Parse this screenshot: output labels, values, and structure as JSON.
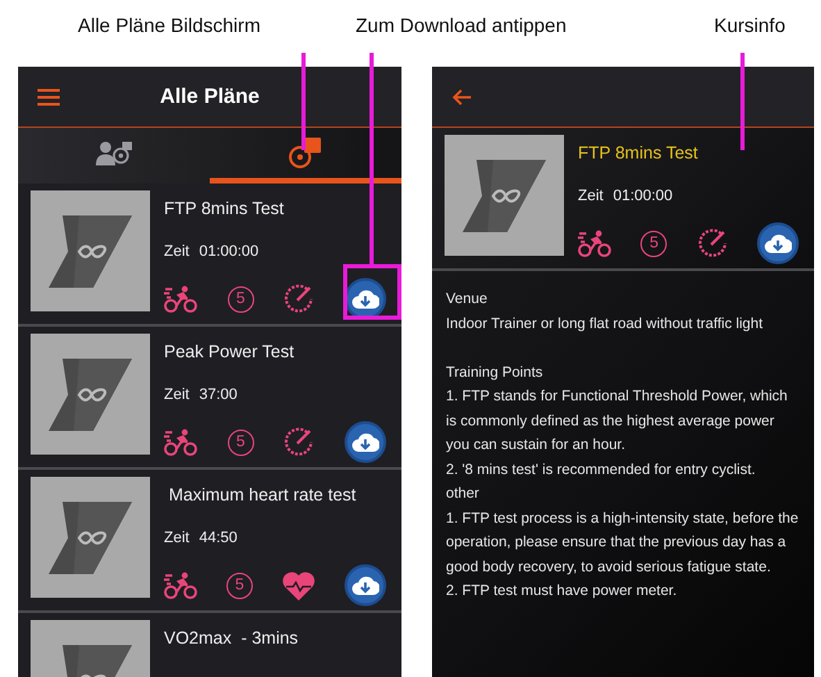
{
  "annotations": [
    {
      "text": "Alle Pläne Bildschirm",
      "kind": "tabs"
    },
    {
      "text": "Zum Download antippen",
      "kind": "download"
    },
    {
      "text": "Kursinfo",
      "kind": "info"
    }
  ],
  "list_screen": {
    "title": "Alle Pläne",
    "tabs": [
      {
        "kind": "person",
        "selected": false
      },
      {
        "kind": "stopwatch",
        "selected": true
      }
    ],
    "plans": [
      {
        "name": "FTP 8mins Test",
        "time_label": "Zeit",
        "time": "01:00:00",
        "level": "5",
        "kind": "gauge",
        "highlighted": true
      },
      {
        "name": "Peak Power Test",
        "time_label": "Zeit",
        "time": "37:00",
        "level": "5",
        "kind": "gauge",
        "highlighted": false
      },
      {
        "name": " Maximum heart rate test",
        "time_label": "Zeit",
        "time": "44:50",
        "level": "5",
        "kind": "heart",
        "highlighted": false
      },
      {
        "name": "VO2max  - 3mins",
        "highlighted": false
      }
    ]
  },
  "detail_screen": {
    "plan": {
      "name": "FTP 8mins Test",
      "time_label": "Zeit",
      "time": "01:00:00",
      "level": "5",
      "kind": "gauge"
    },
    "sections": [
      {
        "lines": [
          "Venue",
          "Indoor Trainer or long flat road without traffic light"
        ]
      },
      {
        "lines": [
          "Training Points",
          "1. FTP stands for Functional Threshold Power, which is commonly defined as the highest average power you can sustain for an hour.",
          "2. '8 mins test' is recommended for entry cyclist.",
          "other",
          "1. FTP test process is a high-intensity state, before the operation, please ensure that the previous day has a good body recovery, to avoid serious fatigue state.",
          "2. FTP test must have power meter."
        ]
      }
    ]
  }
}
